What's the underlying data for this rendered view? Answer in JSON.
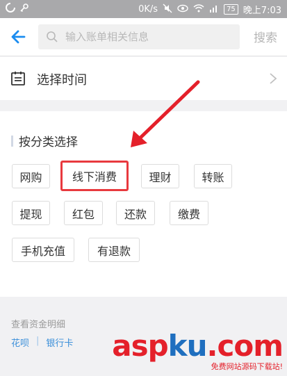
{
  "status_bar": {
    "speed": "0K/s",
    "battery": "75",
    "time": "晚上7:03"
  },
  "search": {
    "placeholder": "输入账单相关信息",
    "button_label": "搜索"
  },
  "time_filter": {
    "label": "选择时间"
  },
  "category": {
    "title": "按分类选择",
    "tags": [
      "网购",
      "线下消费",
      "理财",
      "转账",
      "提现",
      "红包",
      "还款",
      "缴费",
      "手机充值",
      "有退款"
    ],
    "highlighted": "线下消费"
  },
  "funds": {
    "title": "查看资金明细",
    "links": [
      "花呗",
      "银行卡"
    ],
    "separator": "|"
  },
  "watermark": {
    "brand_a": "asp",
    "brand_b": "ku",
    "brand_c": ".com",
    "tagline": "免费网站源码下载站!"
  },
  "colors": {
    "accent": "#3b8fd9",
    "highlight": "#e8393e"
  }
}
